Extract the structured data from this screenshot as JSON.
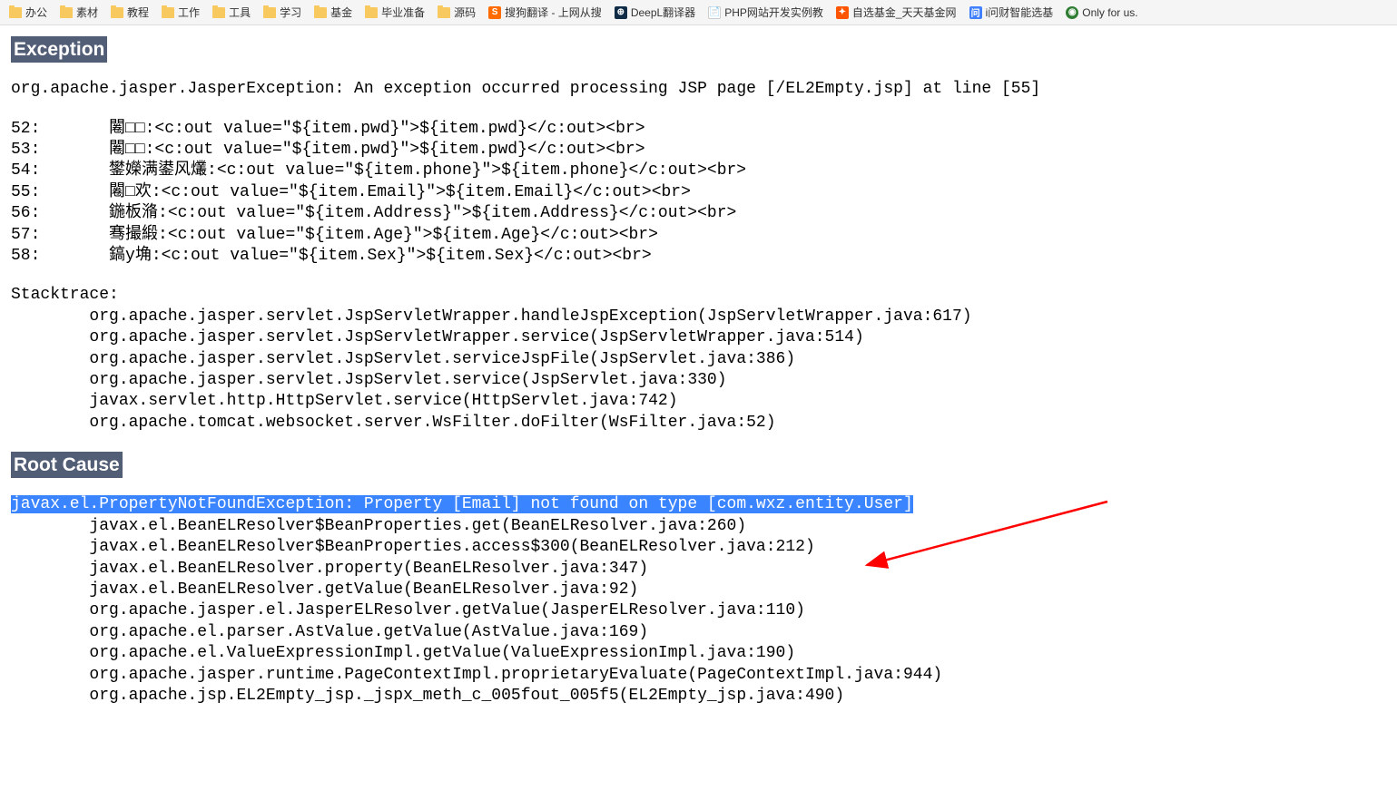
{
  "bookmarks": {
    "folders": [
      "办公",
      "素材",
      "教程",
      "工作",
      "工具",
      "学习",
      "基金",
      "毕业准备",
      "源码"
    ],
    "sites": [
      {
        "label": "搜狗翻译 - 上网从搜",
        "icon": "sogou"
      },
      {
        "label": "DeepL翻译器",
        "icon": "deepl"
      },
      {
        "label": "PHP网站开发实例教",
        "icon": "php"
      },
      {
        "label": "自选基金_天天基金网",
        "icon": "fund"
      },
      {
        "label": "i问财智能选基",
        "icon": "wealth"
      },
      {
        "label": "Only for us.",
        "icon": "only"
      }
    ]
  },
  "error": {
    "exception_header": "Exception",
    "exception_message": "org.apache.jasper.JasperException: An exception occurred processing JSP page [/EL2Empty.jsp] at line [55]",
    "code_block": "52:       闂□□:<c:out value=\"${item.pwd}\">${item.pwd}</c:out><br>\n53:       闂□□:<c:out value=\"${item.pwd}\">${item.pwd}</c:out><br>\n54:       鐢嬫满鍙风爜:<c:out value=\"${item.phone}\">${item.phone}</c:out><br>\n55:       闂□欢:<c:out value=\"${item.Email}\">${item.Email}</c:out><br>\n56:       鍦板潃:<c:out value=\"${item.Address}\">${item.Address}</c:out><br>\n57:       骞撮緞:<c:out value=\"${item.Age}\">${item.Age}</c:out><br>\n58:       鎬у埆:<c:out value=\"${item.Sex}\">${item.Sex}</c:out><br>",
    "stacktrace_label": "Stacktrace:",
    "stacktrace": "        org.apache.jasper.servlet.JspServletWrapper.handleJspException(JspServletWrapper.java:617)\n        org.apache.jasper.servlet.JspServletWrapper.service(JspServletWrapper.java:514)\n        org.apache.jasper.servlet.JspServlet.serviceJspFile(JspServlet.java:386)\n        org.apache.jasper.servlet.JspServlet.service(JspServlet.java:330)\n        javax.servlet.http.HttpServlet.service(HttpServlet.java:742)\n        org.apache.tomcat.websocket.server.WsFilter.doFilter(WsFilter.java:52)",
    "root_cause_header": "Root Cause",
    "root_cause_highlighted": "javax.el.PropertyNotFoundException: Property [Email] not found on type [com.wxz.entity.User]",
    "root_cause_stack": "        javax.el.BeanELResolver$BeanProperties.get(BeanELResolver.java:260)\n        javax.el.BeanELResolver$BeanProperties.access$300(BeanELResolver.java:212)\n        javax.el.BeanELResolver.property(BeanELResolver.java:347)\n        javax.el.BeanELResolver.getValue(BeanELResolver.java:92)\n        org.apache.jasper.el.JasperELResolver.getValue(JasperELResolver.java:110)\n        org.apache.el.parser.AstValue.getValue(AstValue.java:169)\n        org.apache.el.ValueExpressionImpl.getValue(ValueExpressionImpl.java:190)\n        org.apache.jasper.runtime.PageContextImpl.proprietaryEvaluate(PageContextImpl.java:944)\n        org.apache.jsp.EL2Empty_jsp._jspx_meth_c_005fout_005f5(EL2Empty_jsp.java:490)"
  }
}
